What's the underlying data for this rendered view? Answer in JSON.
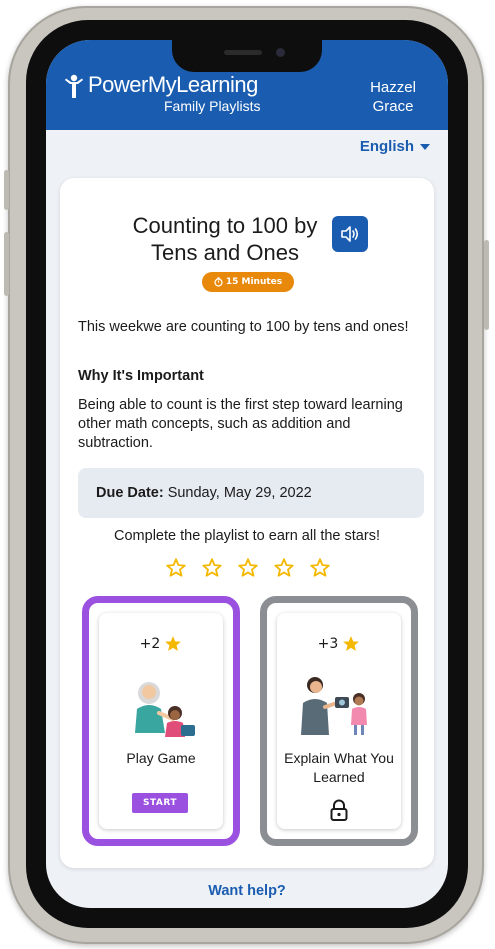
{
  "header": {
    "brand_name": "PowerMyLearning",
    "brand_sub": "Family Playlists",
    "user_name": "Hazzel Grace"
  },
  "language": {
    "selected": "English"
  },
  "playlist": {
    "title": "Counting to 100 by Tens and Ones",
    "duration": "15 Minutes",
    "intro": "This weekwe are counting to 100 by tens and ones!",
    "why_heading": "Why It's Important",
    "why_text": "Being able to count is the first step toward learning other math concepts, such as addition and subtraction.",
    "due_label": "Due Date:",
    "due_value": "Sunday, May 29, 2022",
    "stars_message": "Complete the playlist to earn all the stars!",
    "stars_total": 5,
    "stars_earned": 0
  },
  "activities": [
    {
      "points": "+2",
      "name": "Play Game",
      "action_label": "START",
      "locked": false,
      "border_color": "#9b51e0"
    },
    {
      "points": "+3",
      "name": "Explain What You Learned",
      "locked": true,
      "border_color": "#8b8e93"
    }
  ],
  "footer": {
    "help_link": "Want help?"
  },
  "colors": {
    "header_blue": "#1a5db0",
    "badge_orange": "#e8890c",
    "star_yellow": "#f5b800",
    "active_purple": "#9b51e0",
    "locked_gray": "#8b8e93"
  },
  "icons": [
    "logo-figure-icon",
    "speaker-icon",
    "timer-icon",
    "star-outline-icon",
    "star-filled-icon",
    "lock-icon",
    "chevron-down-icon"
  ]
}
